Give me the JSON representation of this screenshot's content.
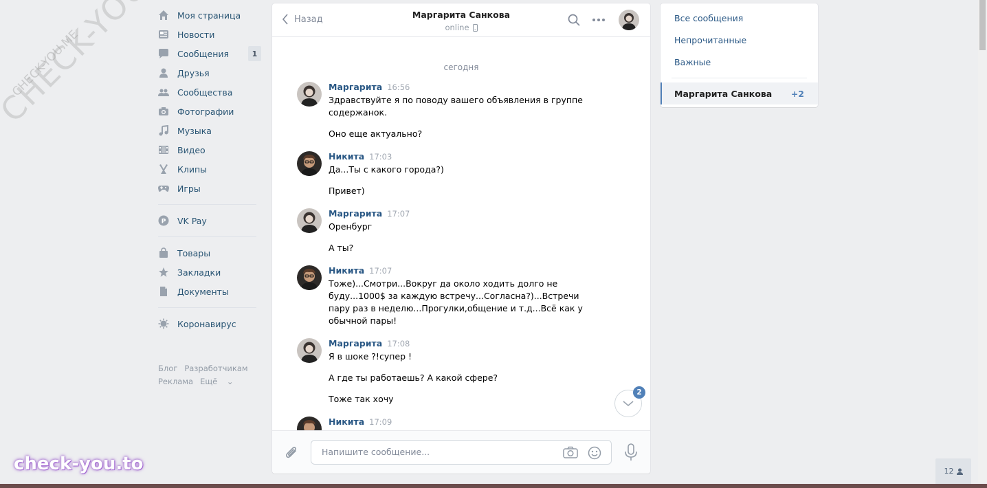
{
  "watermark": {
    "big": "CHECK-YOU.ME",
    "small": "CHECK-YOU.ME",
    "brand": "check-you.to"
  },
  "leftnav": {
    "items": [
      {
        "label": "Моя страница",
        "icon": "home-icon"
      },
      {
        "label": "Новости",
        "icon": "news-icon"
      },
      {
        "label": "Сообщения",
        "icon": "messages-icon",
        "badge": "1"
      },
      {
        "label": "Друзья",
        "icon": "friends-icon"
      },
      {
        "label": "Сообщества",
        "icon": "communities-icon"
      },
      {
        "label": "Фотографии",
        "icon": "camera-icon"
      },
      {
        "label": "Музыка",
        "icon": "music-icon"
      },
      {
        "label": "Видео",
        "icon": "video-icon"
      },
      {
        "label": "Клипы",
        "icon": "clips-icon"
      },
      {
        "label": "Игры",
        "icon": "gamepad-icon"
      }
    ],
    "pay": {
      "label": "VK Pay",
      "icon": "vkpay-icon"
    },
    "items2": [
      {
        "label": "Товары",
        "icon": "bag-icon"
      },
      {
        "label": "Закладки",
        "icon": "star-icon"
      },
      {
        "label": "Документы",
        "icon": "document-icon"
      }
    ],
    "covid": {
      "label": "Коронавирус",
      "icon": "virus-icon"
    },
    "footer": {
      "blog": "Блог",
      "dev": "Разработчикам",
      "ads": "Реклама",
      "more": "Ещё"
    }
  },
  "chat": {
    "back_label": "Назад",
    "peer_name": "Маргарита Санкова",
    "peer_status": "online",
    "date_separator": "сегодня",
    "messages": [
      {
        "author": "Маргарита",
        "time": "16:56",
        "lines": [
          "Здравствуйте я по поводу вашего объявления в группе содержанок.",
          "Оно еще актуально?"
        ]
      },
      {
        "author": "Никита",
        "time": "17:03",
        "lines": [
          "Да...Ты с какого города?)",
          "Привет)"
        ]
      },
      {
        "author": "Маргарита",
        "time": "17:07",
        "lines": [
          "Оренбург",
          "А ты?"
        ]
      },
      {
        "author": "Никита",
        "time": "17:07",
        "lines": [
          "Тоже)...Смотри...Вокруг да около ходить долго не буду...1000$ за каждую встречу...Согласна?)...Встречи пару раз в неделю...Прогулки,общение и т.д...Всё как у обычной пары!"
        ]
      },
      {
        "author": "Маргарита",
        "time": "17:08",
        "lines": [
          "Я в шоке ?!супер !",
          "А где ты работаешь? А какой сфере?",
          "Тоже так хочу"
        ]
      },
      {
        "author": "Никита",
        "time": "17:09",
        "lines": []
      }
    ],
    "unread_scroll_count": "2",
    "input_placeholder": "Напишите сообщение..."
  },
  "rightnav": {
    "all": "Все сообщения",
    "unread": "Непрочитанные",
    "important": "Важные",
    "active_name": "Маргарита Санкова",
    "active_count": "+2"
  },
  "online_count": "12",
  "colors": {
    "link": "#2a5885",
    "accent": "#5181b8",
    "bg": "#edeef0"
  }
}
